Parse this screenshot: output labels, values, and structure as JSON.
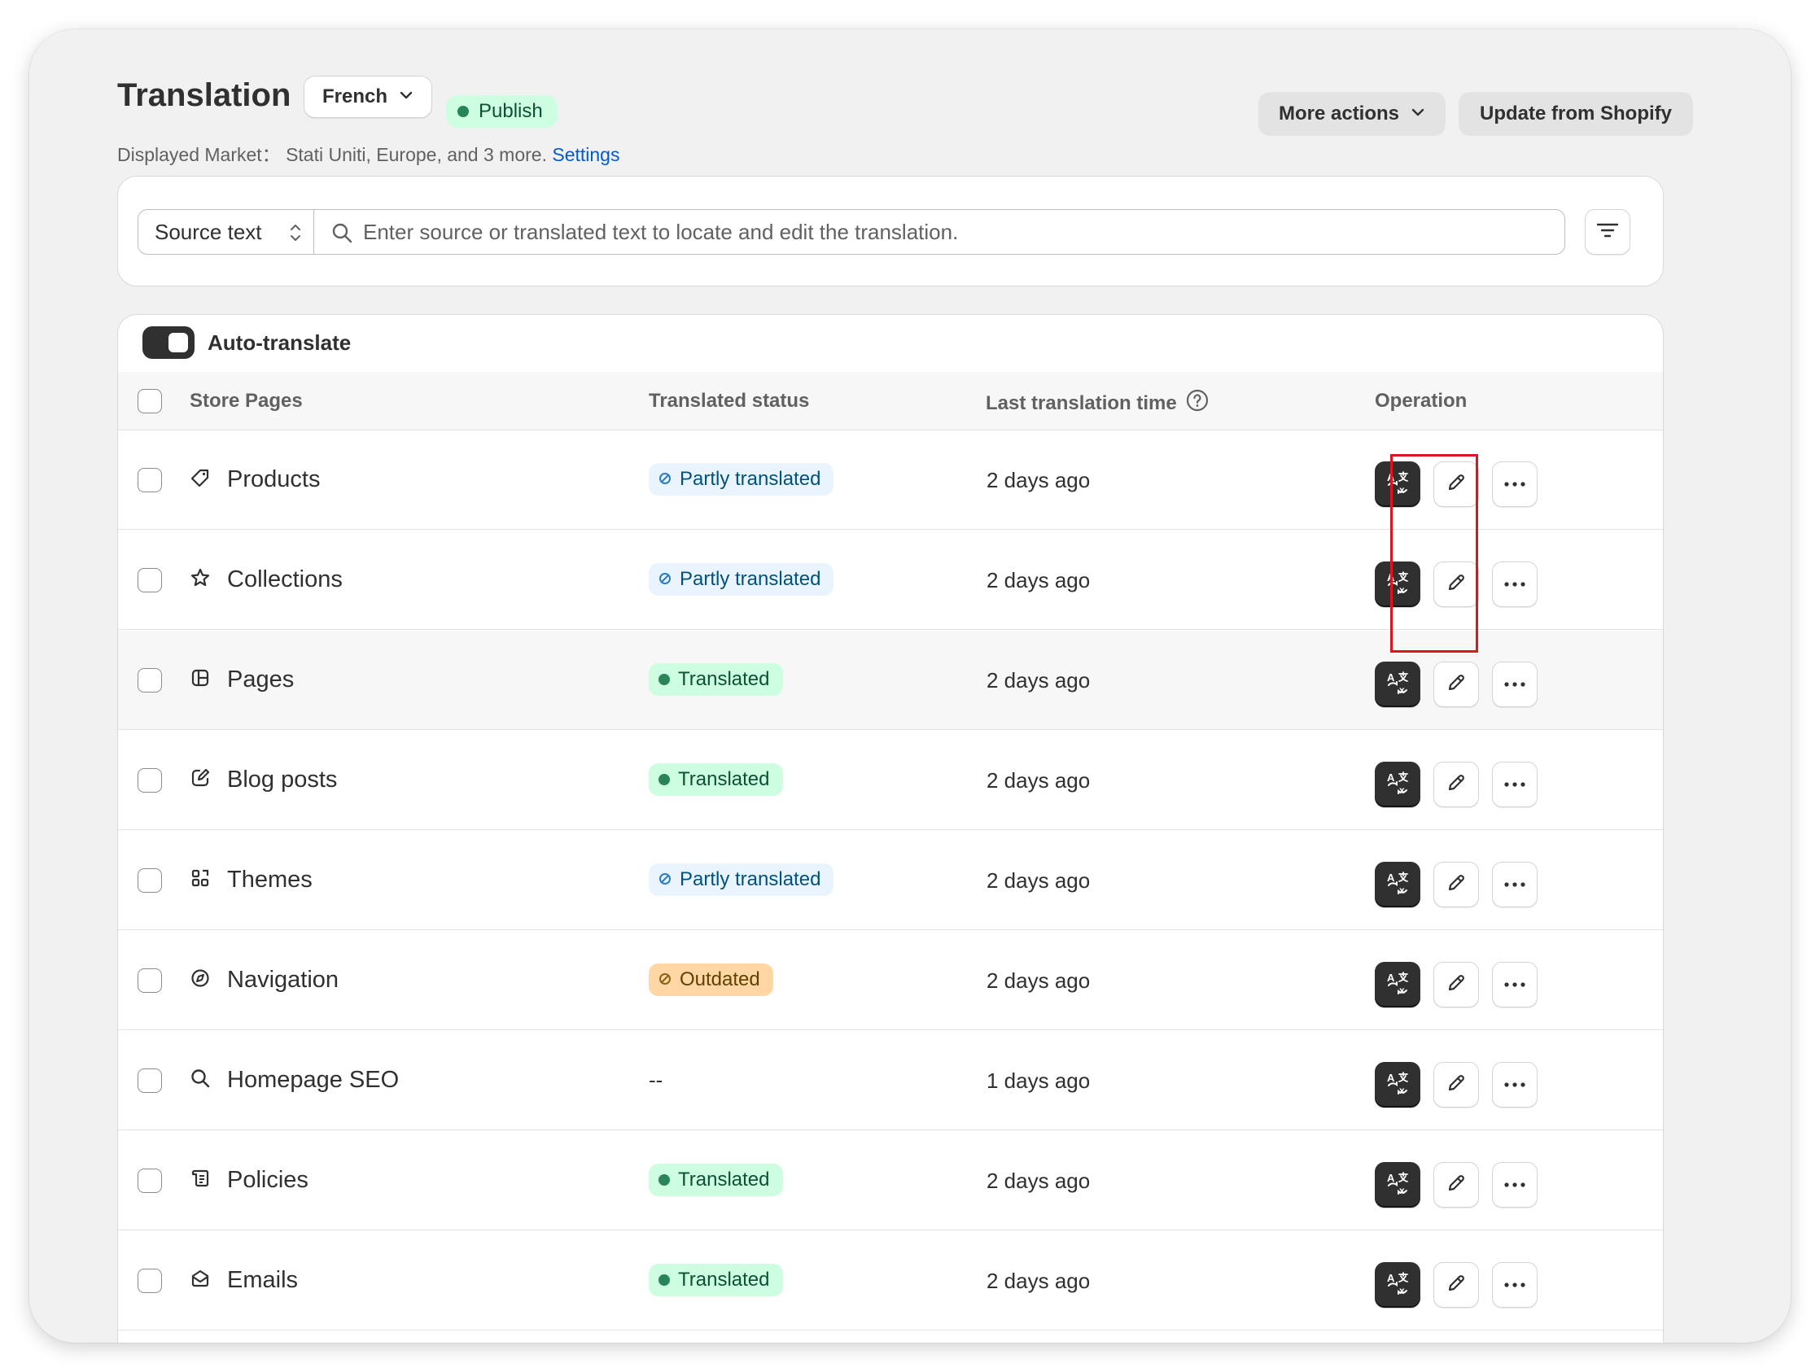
{
  "header": {
    "title": "Translation",
    "language": "French",
    "publish_label": "Publish",
    "market_prefix": "Displayed Market： Stati Uniti, Europe, and 3 more.",
    "settings_link": "Settings",
    "more_actions": "More actions",
    "update_button": "Update from Shopify"
  },
  "search": {
    "source_select": "Source text",
    "placeholder": "Enter source or translated text to locate and edit the translation."
  },
  "table": {
    "auto_translate_label": "Auto-translate",
    "auto_translate_on": true,
    "columns": {
      "store_pages": "Store Pages",
      "status": "Translated status",
      "time": "Last translation time",
      "operation": "Operation"
    },
    "rows": [
      {
        "name": "Products",
        "icon": "tag-icon",
        "status": "Partly translated",
        "status_kind": "partly",
        "time": "2 days ago"
      },
      {
        "name": "Collections",
        "icon": "star-icon",
        "status": "Partly translated",
        "status_kind": "partly",
        "time": "2 days ago"
      },
      {
        "name": "Pages",
        "icon": "layout-icon",
        "status": "Translated",
        "status_kind": "translated",
        "time": "2 days ago"
      },
      {
        "name": "Blog posts",
        "icon": "compose-icon",
        "status": "Translated",
        "status_kind": "translated",
        "time": "2 days ago"
      },
      {
        "name": "Themes",
        "icon": "apps-icon",
        "status": "Partly translated",
        "status_kind": "partly",
        "time": "2 days ago"
      },
      {
        "name": "Navigation",
        "icon": "compass-icon",
        "status": "Outdated",
        "status_kind": "outdated",
        "time": "2 days ago"
      },
      {
        "name": "Homepage SEO",
        "icon": "search-icon",
        "status": "--",
        "status_kind": "none",
        "time": "1 days ago"
      },
      {
        "name": "Policies",
        "icon": "policy-icon",
        "status": "Translated",
        "status_kind": "translated",
        "time": "2 days ago"
      },
      {
        "name": "Emails",
        "icon": "email-icon",
        "status": "Translated",
        "status_kind": "translated",
        "time": "2 days ago"
      }
    ]
  },
  "colors": {
    "primary_dark": "#303030",
    "link": "#005bd3",
    "success_bg": "#cdfee1",
    "info_bg": "#eaf4ff",
    "warning_bg": "#ffd6a4",
    "highlight": "#e0141e"
  }
}
